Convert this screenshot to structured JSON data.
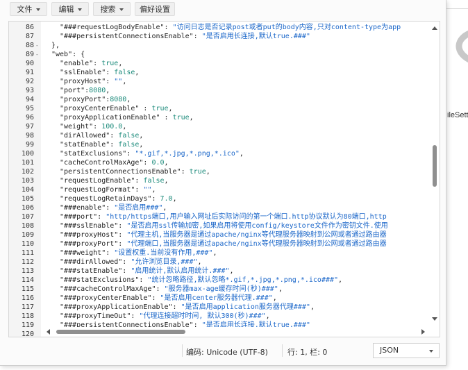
{
  "toolbar": {
    "file": "文件",
    "edit": "编辑",
    "search": "搜索",
    "preferences": "偏好设置"
  },
  "editor": {
    "lines": [
      {
        "n": "86",
        "fold": "",
        "indent": 2,
        "parts": [
          [
            "k",
            "\"###requestLogBodyEnable\": "
          ],
          [
            "s",
            "\"访问日志是否记录post或者put的body内容,只对content-type为app"
          ]
        ]
      },
      {
        "n": "87",
        "fold": "",
        "indent": 2,
        "parts": [
          [
            "k",
            "\"###persistentConnectionsEnable\": "
          ],
          [
            "s",
            "\"是否启用长连接,默认true.###\""
          ]
        ]
      },
      {
        "n": "88",
        "fold": "-",
        "indent": 1,
        "parts": [
          [
            "k",
            "},"
          ]
        ]
      },
      {
        "n": "89",
        "fold": "-",
        "indent": 1,
        "parts": [
          [
            "k",
            "\"web\": {"
          ]
        ]
      },
      {
        "n": "90",
        "fold": "",
        "indent": 2,
        "parts": [
          [
            "k",
            "\"enable\": "
          ],
          [
            "v",
            "true"
          ],
          [
            "k",
            ","
          ]
        ]
      },
      {
        "n": "91",
        "fold": "",
        "indent": 2,
        "parts": [
          [
            "k",
            "\"sslEnable\": "
          ],
          [
            "v",
            "false"
          ],
          [
            "k",
            ","
          ]
        ]
      },
      {
        "n": "92",
        "fold": "",
        "indent": 2,
        "parts": [
          [
            "k",
            "\"proxyHost\": "
          ],
          [
            "s",
            "\"\""
          ],
          [
            "k",
            ","
          ]
        ]
      },
      {
        "n": "93",
        "fold": "",
        "indent": 2,
        "parts": [
          [
            "k",
            "\"port\":"
          ],
          [
            "v",
            "8080"
          ],
          [
            "k",
            ","
          ]
        ]
      },
      {
        "n": "94",
        "fold": "",
        "indent": 2,
        "parts": [
          [
            "k",
            "\"proxyPort\":"
          ],
          [
            "v",
            "8080"
          ],
          [
            "k",
            ","
          ]
        ]
      },
      {
        "n": "95",
        "fold": "",
        "indent": 2,
        "parts": [
          [
            "k",
            "\"proxyCenterEnable\" : "
          ],
          [
            "v",
            "true"
          ],
          [
            "k",
            ","
          ]
        ]
      },
      {
        "n": "96",
        "fold": "",
        "indent": 2,
        "parts": [
          [
            "k",
            "\"proxyApplicationEnable\" : "
          ],
          [
            "v",
            "true"
          ],
          [
            "k",
            ","
          ]
        ]
      },
      {
        "n": "97",
        "fold": "",
        "indent": 2,
        "parts": [
          [
            "k",
            "\"weight\": "
          ],
          [
            "v",
            "100.0"
          ],
          [
            "k",
            ","
          ]
        ]
      },
      {
        "n": "98",
        "fold": "",
        "indent": 2,
        "parts": [
          [
            "k",
            "\"dirAllowed\": "
          ],
          [
            "v",
            "false"
          ],
          [
            "k",
            ","
          ]
        ]
      },
      {
        "n": "99",
        "fold": "",
        "indent": 2,
        "parts": [
          [
            "k",
            "\"statEnable\": "
          ],
          [
            "v",
            "false"
          ],
          [
            "k",
            ","
          ]
        ]
      },
      {
        "n": "100",
        "fold": "",
        "indent": 2,
        "parts": [
          [
            "k",
            "\"statExclusions\": "
          ],
          [
            "s",
            "\"*.gif,*.jpg,*.png,*.ico\""
          ],
          [
            "k",
            ","
          ]
        ]
      },
      {
        "n": "101",
        "fold": "",
        "indent": 2,
        "parts": [
          [
            "k",
            "\"cacheControlMaxAge\": "
          ],
          [
            "v",
            "0.0"
          ],
          [
            "k",
            ","
          ]
        ]
      },
      {
        "n": "102",
        "fold": "",
        "indent": 2,
        "parts": [
          [
            "k",
            "\"persistentConnectionsEnable\": "
          ],
          [
            "v",
            "true"
          ],
          [
            "k",
            ","
          ]
        ]
      },
      {
        "n": "103",
        "fold": "",
        "indent": 2,
        "parts": [
          [
            "k",
            "\"requestLogEnable\": "
          ],
          [
            "v",
            "false"
          ],
          [
            "k",
            ","
          ]
        ]
      },
      {
        "n": "104",
        "fold": "",
        "indent": 2,
        "parts": [
          [
            "k",
            "\"requestLogFormat\": "
          ],
          [
            "s",
            "\"\""
          ],
          [
            "k",
            ","
          ]
        ]
      },
      {
        "n": "105",
        "fold": "",
        "indent": 2,
        "parts": [
          [
            "k",
            "\"requestLogRetainDays\": "
          ],
          [
            "v",
            "7.0"
          ],
          [
            "k",
            ","
          ]
        ]
      },
      {
        "n": "106",
        "fold": "",
        "indent": 2,
        "parts": [
          [
            "k",
            "\"###enable\": "
          ],
          [
            "s",
            "\"是否启用###\""
          ],
          [
            "k",
            ","
          ]
        ]
      },
      {
        "n": "107",
        "fold": "",
        "indent": 2,
        "parts": [
          [
            "k",
            "\"###port\": "
          ],
          [
            "s",
            "\"http/https端口,用户输入网址后实际访问的第一个端口.http协议默认为80端口,http"
          ]
        ]
      },
      {
        "n": "108",
        "fold": "",
        "indent": 2,
        "parts": [
          [
            "k",
            "\"###sslEnable\": "
          ],
          [
            "s",
            "\"是否启用ssl传输加密,如果启用将使用config/keystore文件作为密钥文件.使用"
          ]
        ]
      },
      {
        "n": "109",
        "fold": "",
        "indent": 2,
        "parts": [
          [
            "k",
            "\"###proxyHost\": "
          ],
          [
            "s",
            "\"代理主机,当服务器是通过apache/nginx等代理服务器映射到公网或者通过路由器"
          ]
        ]
      },
      {
        "n": "110",
        "fold": "",
        "indent": 2,
        "parts": [
          [
            "k",
            "\"###proxyPort\": "
          ],
          [
            "s",
            "\"代理端口,当服务器是通过apache/nginx等代理服务器映射到公网或者通过路由器"
          ]
        ]
      },
      {
        "n": "111",
        "fold": "",
        "indent": 2,
        "parts": [
          [
            "k",
            "\"###weight\": "
          ],
          [
            "s",
            "\"设置权重.当前没有作用,###\""
          ],
          [
            "k",
            ","
          ]
        ]
      },
      {
        "n": "112",
        "fold": "",
        "indent": 2,
        "parts": [
          [
            "k",
            "\"###dirAllowed\": "
          ],
          [
            "s",
            "\"允许浏览目录,###\""
          ],
          [
            "k",
            ","
          ]
        ]
      },
      {
        "n": "113",
        "fold": "",
        "indent": 2,
        "parts": [
          [
            "k",
            "\"###statEnable\": "
          ],
          [
            "s",
            "\"启用统计,默认启用统计.###\""
          ],
          [
            "k",
            ","
          ]
        ]
      },
      {
        "n": "114",
        "fold": "",
        "indent": 2,
        "parts": [
          [
            "k",
            "\"###statExclusions\": "
          ],
          [
            "s",
            "\"统计忽略路径,默认忽略*.gif,*.jpg,*.png,*.ico###\""
          ],
          [
            "k",
            ","
          ]
        ]
      },
      {
        "n": "115",
        "fold": "",
        "indent": 2,
        "parts": [
          [
            "k",
            "\"###cacheControlMaxAge\": "
          ],
          [
            "s",
            "\"服务器max-age缓存时间(秒)###\""
          ],
          [
            "k",
            ","
          ]
        ]
      },
      {
        "n": "116",
        "fold": "",
        "indent": 2,
        "parts": [
          [
            "k",
            "\"###proxyCenterEnable\": "
          ],
          [
            "s",
            "\"是否启用center服务器代理.###\""
          ],
          [
            "k",
            ","
          ]
        ]
      },
      {
        "n": "117",
        "fold": "",
        "indent": 2,
        "parts": [
          [
            "k",
            "\"###proxyApplicationEnable\": "
          ],
          [
            "s",
            "\"是否启用application服务器代理###\""
          ],
          [
            "k",
            ","
          ]
        ]
      },
      {
        "n": "118",
        "fold": "",
        "indent": 2,
        "parts": [
          [
            "k",
            "\"###proxyTimeOut\": "
          ],
          [
            "s",
            "\"代理连接超时时间, 默认300(秒)###\""
          ],
          [
            "k",
            ","
          ]
        ]
      },
      {
        "n": "119",
        "fold": "",
        "indent": 2,
        "parts": [
          [
            "k",
            "\"###persistentConnectionsEnable\": "
          ],
          [
            "s",
            "\"是否启用长连接,默认true.###\""
          ]
        ]
      },
      {
        "n": "120",
        "fold": "",
        "indent": 2,
        "parts": [
          [
            "k",
            ""
          ]
        ]
      }
    ]
  },
  "status": {
    "encoding": "编码: Unicode (UTF-8)",
    "position": "行: 1, 栏: 0",
    "mode": "JSON"
  },
  "background": {
    "partial_label": "ileSett"
  }
}
